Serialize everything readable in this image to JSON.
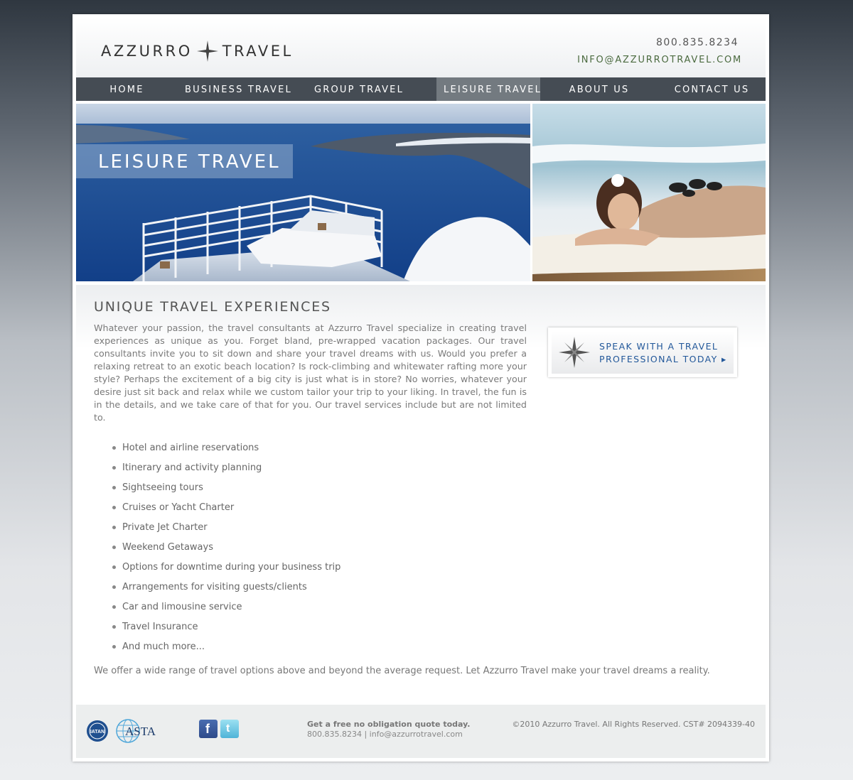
{
  "header": {
    "logo_left": "AZZURRO",
    "logo_right": "TRAVEL",
    "phone": "800.835.8234",
    "email": "INFO@AZZURROTRAVEL.COM"
  },
  "nav": {
    "items": [
      {
        "label": "HOME"
      },
      {
        "label": "BUSINESS TRAVEL"
      },
      {
        "label": "GROUP TRAVEL"
      },
      {
        "label": "LEISURE TRAVEL",
        "active": true
      },
      {
        "label": "ABOUT US"
      },
      {
        "label": "CONTACT US"
      }
    ]
  },
  "hero": {
    "label": "LEISURE TRAVEL"
  },
  "main": {
    "title": "UNIQUE TRAVEL EXPERIENCES",
    "intro": "Whatever your passion, the travel consultants at Azzurro Travel specialize in creating travel experiences as unique as you. Forget bland, pre-wrapped vacation packages. Our travel consultants invite you to sit down and share your travel dreams with us. Would you prefer a relaxing retreat to an exotic beach location? Is rock-climbing and whitewater rafting more your style? Perhaps the excitement of a big city is just what is in store? No worries, whatever your desire just sit back and relax while we custom tailor your trip to your liking. In travel, the fun is in the details, and we take care of that for you. Our travel services include but are not limited to.",
    "services": [
      "Hotel and airline reservations",
      "Itinerary and activity planning",
      "Sightseeing tours",
      "Cruises or Yacht Charter",
      "Private Jet Charter",
      "Weekend Getaways",
      "Options for downtime during your business trip",
      "Arrangements for visiting guests/clients",
      "Car and limousine service",
      "Travel Insurance",
      "And much more..."
    ],
    "closing": "We offer a wide range of travel options above and beyond the average request. Let Azzurro Travel make your travel dreams a reality."
  },
  "cta": {
    "line1": "SPEAK WITH A TRAVEL",
    "line2": "PROFESSIONAL TODAY ▸"
  },
  "footer": {
    "iata_label": "IATAN",
    "asta_label": "ASTA",
    "quote_title": "Get a free no obligation quote today.",
    "quote_contact": "800.835.8234 | info@azzurrotravel.com",
    "copyright": "©2010 Azzurro Travel. All Rights Reserved. CST# 2094339-40"
  },
  "colors": {
    "nav_bg": "#454c54",
    "nav_active": "#737a80",
    "email": "#4b6a3f",
    "cta_text": "#23589a"
  },
  "icons": [
    "compass-star-icon",
    "facebook-icon",
    "twitter-icon",
    "iatan-badge-icon",
    "asta-globe-icon"
  ]
}
